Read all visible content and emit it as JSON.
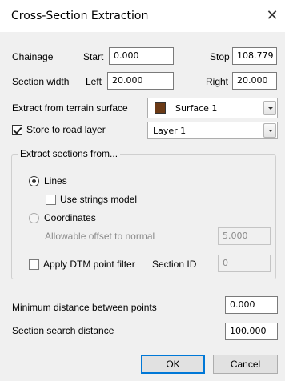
{
  "window": {
    "title": "Cross-Section Extraction",
    "close_glyph": "✕"
  },
  "chainage": {
    "label": "Chainage",
    "start_label": "Start",
    "start_value": "0.000",
    "stop_label": "Stop",
    "stop_value": "108.779"
  },
  "section_width": {
    "label": "Section width",
    "left_label": "Left",
    "left_value": "20.000",
    "right_label": "Right",
    "right_value": "20.000"
  },
  "terrain": {
    "label": "Extract from terrain surface",
    "selected": "Surface 1",
    "swatch_color": "#6b3a16"
  },
  "road_layer": {
    "label": "Store to road layer",
    "checked": true,
    "selected": "Layer 1"
  },
  "extract_group": {
    "title": "Extract sections from...",
    "lines_label": "Lines",
    "lines_selected": true,
    "use_strings_label": "Use strings model",
    "use_strings_checked": false,
    "coordinates_label": "Coordinates",
    "coordinates_selected": false,
    "offset_label": "Allowable offset to normal",
    "offset_value": "5.000",
    "dtm_filter_label": "Apply DTM point filter",
    "dtm_filter_checked": false,
    "section_id_label": "Section ID",
    "section_id_value": "0"
  },
  "min_distance": {
    "label": "Minimum distance between points",
    "value": "0.000"
  },
  "search_distance": {
    "label": "Section search distance",
    "value": "100.000"
  },
  "buttons": {
    "ok": "OK",
    "cancel": "Cancel"
  }
}
